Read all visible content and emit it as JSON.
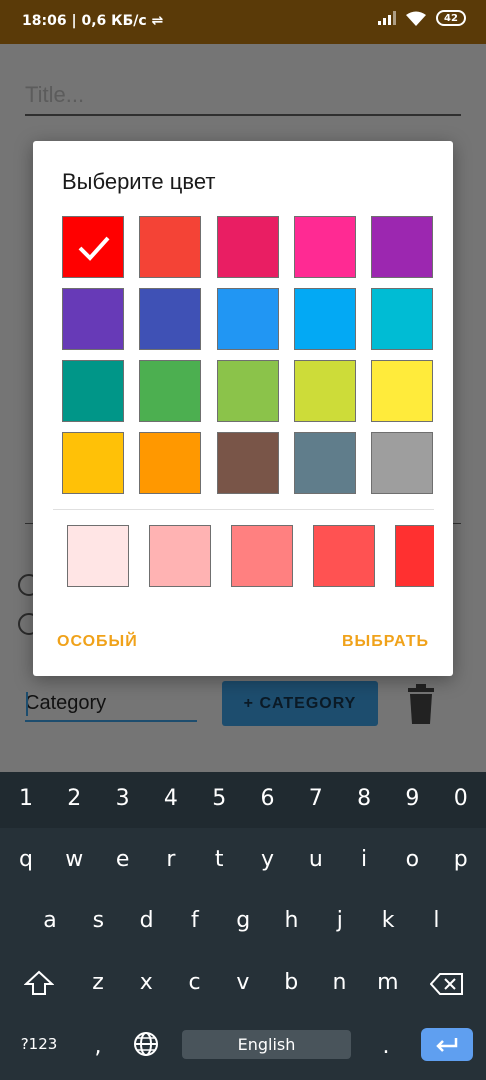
{
  "status_bar": {
    "time": "18:06",
    "network_speed": "0,6 КБ/с",
    "battery_level": "42"
  },
  "note_editor": {
    "title_placeholder": "Title...",
    "category_value": "Category",
    "add_category_label": "+ CATEGORY"
  },
  "color_dialog": {
    "title": "Выберите цвет",
    "selected_color": "#FF0000",
    "colors": [
      "#FF0000",
      "#F44336",
      "#E91E63",
      "#FF2A93",
      "#9C27B0",
      "#673AB7",
      "#3F51B5",
      "#2196F3",
      "#03A9F4",
      "#00BCD4",
      "#009688",
      "#4CAF50",
      "#8BC34A",
      "#CDDC39",
      "#FFEB3B",
      "#FFC107",
      "#FF9800",
      "#795548",
      "#607D8B",
      "#9E9E9E"
    ],
    "shades": [
      "#FFE5E5",
      "#FFB3B3",
      "#FF8080",
      "#FF5252",
      "#FF3030"
    ],
    "custom_button": "ОСОБЫЙ",
    "select_button": "ВЫБРАТЬ"
  },
  "keyboard": {
    "number_row": [
      "1",
      "2",
      "3",
      "4",
      "5",
      "6",
      "7",
      "8",
      "9",
      "0"
    ],
    "row1": [
      "q",
      "w",
      "e",
      "r",
      "t",
      "y",
      "u",
      "i",
      "o",
      "p"
    ],
    "row2": [
      "a",
      "s",
      "d",
      "f",
      "g",
      "h",
      "j",
      "k",
      "l"
    ],
    "row3": [
      "z",
      "x",
      "c",
      "v",
      "b",
      "n",
      "m"
    ],
    "symbols_key": "?123",
    "comma_key": ",",
    "space_label": "English",
    "period_key": "."
  }
}
